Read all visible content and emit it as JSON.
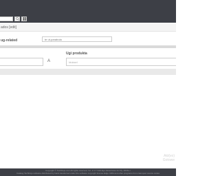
{
  "toolbar": {
    "search_icon": "search-icon",
    "grid_icon": "grid-icon"
  },
  "breadcrumb": {
    "text": "ados [edit]"
  },
  "form": {
    "field_label": "ug-related",
    "select_text": "te ut-parabola",
    "select_icon": "chevron-down-icon"
  },
  "relations": {
    "column_header": "Ugi produkta",
    "a_glyph": "A",
    "right_placeholder": "Iduksel"
  },
  "watermark": {
    "line1": "Akt(vo)",
    "line2": "Gotowe"
  },
  "footer": {
    "line1": "Copyright © TechDojo.com All rights reserved, Inc. 2.1.7 Odd Eye Adventures Inc Ry. 2015e-r",
    "line2": "Catalog TechDojo software distributed by hand transferred under the software copyright license Edge CDM and other programs from cast open source codes"
  }
}
